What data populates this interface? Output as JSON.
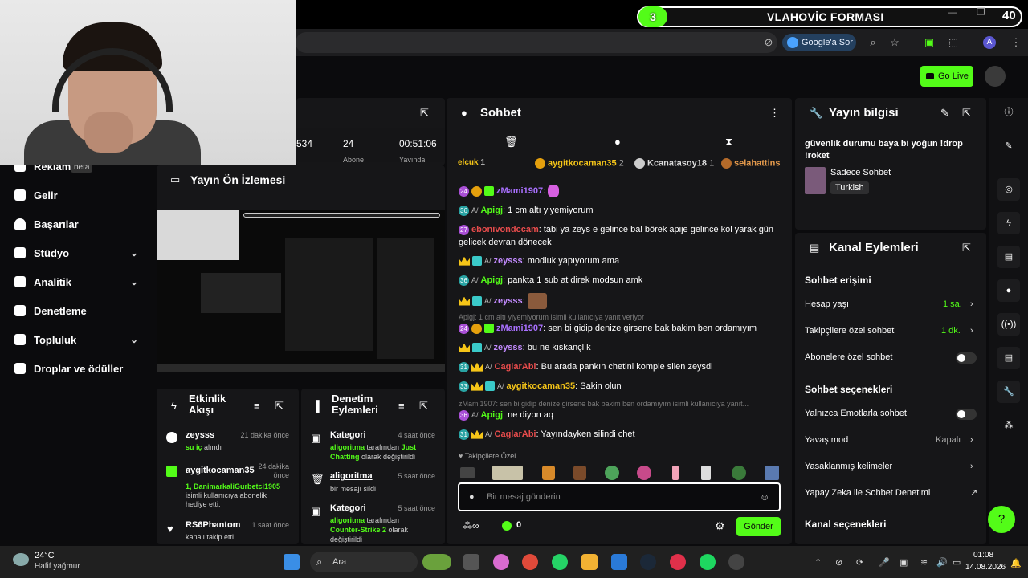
{
  "banner": {
    "number": "3",
    "title": "VLAHOVİC FORMASI",
    "count": "40"
  },
  "browser": {
    "google": "Google'a Sor",
    "avatar": "A"
  },
  "header": {
    "golive": "Go Live"
  },
  "sidebar": {
    "items": [
      {
        "label": "Reklam",
        "badge": "beta"
      },
      {
        "label": "Gelir"
      },
      {
        "label": "Başarılar"
      },
      {
        "label": "Stüdyo"
      },
      {
        "label": "Analitik"
      },
      {
        "label": "Denetleme"
      },
      {
        "label": "Topluluk"
      },
      {
        "label": "Droplar ve ödüller"
      }
    ]
  },
  "stats": {
    "v1": "534",
    "v2": "24",
    "v3": "00:51:06",
    "l2": "Abone",
    "l3": "Yayında"
  },
  "preview": {
    "title": "Yayın Ön İzlemesi"
  },
  "activity": {
    "title": "Etkinlik Akışı",
    "items": [
      {
        "name": "zeysss",
        "time": "21 dakika önce",
        "sub": "su iç",
        "rest": "alındı"
      },
      {
        "name": "aygitkocaman35",
        "time": "24 dakika önce",
        "sub": "1, DanimarkaliGurbetci1905",
        "rest": "isimli kullanıcıya abonelik hediye etti."
      },
      {
        "name": "RS6Phantom",
        "time": "1 saat önce",
        "rest": "kanalı takip etti"
      }
    ]
  },
  "modactions": {
    "title": "Denetim Eylemleri",
    "items": [
      {
        "name": "Kategori",
        "time": "4 saat önce",
        "who": "aligoritma",
        "mid": "tarafından",
        "what": "Just Chatting",
        "rest": "olarak değiştirildi"
      },
      {
        "name": "aligoritma",
        "time": "5 saat önce",
        "rest": "bir mesajı sildi"
      },
      {
        "name": "Kategori",
        "time": "5 saat önce",
        "who": "aligoritma",
        "mid": "tarafından",
        "what": "Counter-Strike 2",
        "rest": "olarak değiştirildi"
      }
    ]
  },
  "chat": {
    "title": "Sohbet",
    "pinned": [
      {
        "name": "elcuk",
        "n": "1"
      },
      {
        "name": "aygitkocaman35",
        "n": "2"
      },
      {
        "name": "Kcanatasoy18",
        "n": "1"
      },
      {
        "name": "selahattins"
      }
    ],
    "messages": [
      {
        "badge": "24",
        "name": "zMami1907",
        "color": "#a970ff",
        "text": ""
      },
      {
        "badge": "36",
        "name": "Apigj",
        "color": "#53fc18",
        "text": "1 cm altı yiyemiyorum"
      },
      {
        "badge": "27",
        "name": "ebonivondccam",
        "color": "#e84c4c",
        "text": "tabi ya zeys e gelince bal börek apije gelince kol yarak gün gelicek devran dönecek"
      },
      {
        "name": "zeysss",
        "color": "#c38bff",
        "text": "modluk yapıyorum ama"
      },
      {
        "badge": "36",
        "name": "Apigj",
        "color": "#53fc18",
        "text": "pankta 1 sub at direk modsun amk"
      },
      {
        "name": "zeysss",
        "color": "#c38bff",
        "text": ""
      },
      {
        "reply": "Apigj: 1 cm altı yiyemiyorum isimli kullanıcıya yanıt veriyor"
      },
      {
        "badge": "24",
        "name": "zMami1907",
        "color": "#a970ff",
        "text": "sen bi gidip denize girsene bak bakim ben ordamıyım"
      },
      {
        "name": "zeysss",
        "color": "#c38bff",
        "text": "bu ne kıskançlık"
      },
      {
        "badge": "31",
        "name": "CaglarAbi",
        "color": "#e84c4c",
        "text": "Bu arada pankın chetini komple silen zeysdi"
      },
      {
        "badge": "33",
        "name": "aygitkocaman35",
        "color": "#f5c518",
        "text": "Sakin olun"
      },
      {
        "reply": "zMami1907: sen bi gidip denize girsene bak bakim ben ordamıyım isimli kullanıcıya yanıt..."
      },
      {
        "badge": "36",
        "name": "Apigj",
        "color": "#53fc18",
        "text": "ne diyon aq"
      },
      {
        "badge": "31",
        "name": "CaglarAbi",
        "color": "#e84c4c",
        "text": "Yayındayken silindi chet"
      }
    ],
    "followers_only": "Takipçilere Özel",
    "placeholder": "Bir mesaj gönderin",
    "count": "0",
    "send": "Gönder"
  },
  "info": {
    "title": "Yayın bilgisi",
    "stream_title": "güvenlik durumu baya bi yoğun !drop !roket",
    "category": "Sadece Sohbet",
    "tag": "Turkish"
  },
  "channel": {
    "title": "Kanal Eylemleri",
    "sec1": "Sohbet erişimi",
    "account_age": "Hesap yaşı",
    "account_age_val": "1 sa.",
    "follower_chat": "Takipçilere özel sohbet",
    "follower_chat_val": "1 dk.",
    "sub_chat": "Abonelere özel sohbet",
    "sec2": "Sohbet seçenekleri",
    "emote_only": "Yalnızca Emotlarla sohbet",
    "slow": "Yavaş mod",
    "slow_val": "Kapalı",
    "banned_words": "Yasaklanmış kelimeler",
    "ai_mod": "Yapay Zeka ile Sohbet Denetimi",
    "sec3": "Kanal seçenekleri"
  },
  "taskbar": {
    "temp": "24°C",
    "weather": "Hafif yağmur",
    "search": "Ara",
    "time": "01:08",
    "date": "14.08.2026"
  }
}
